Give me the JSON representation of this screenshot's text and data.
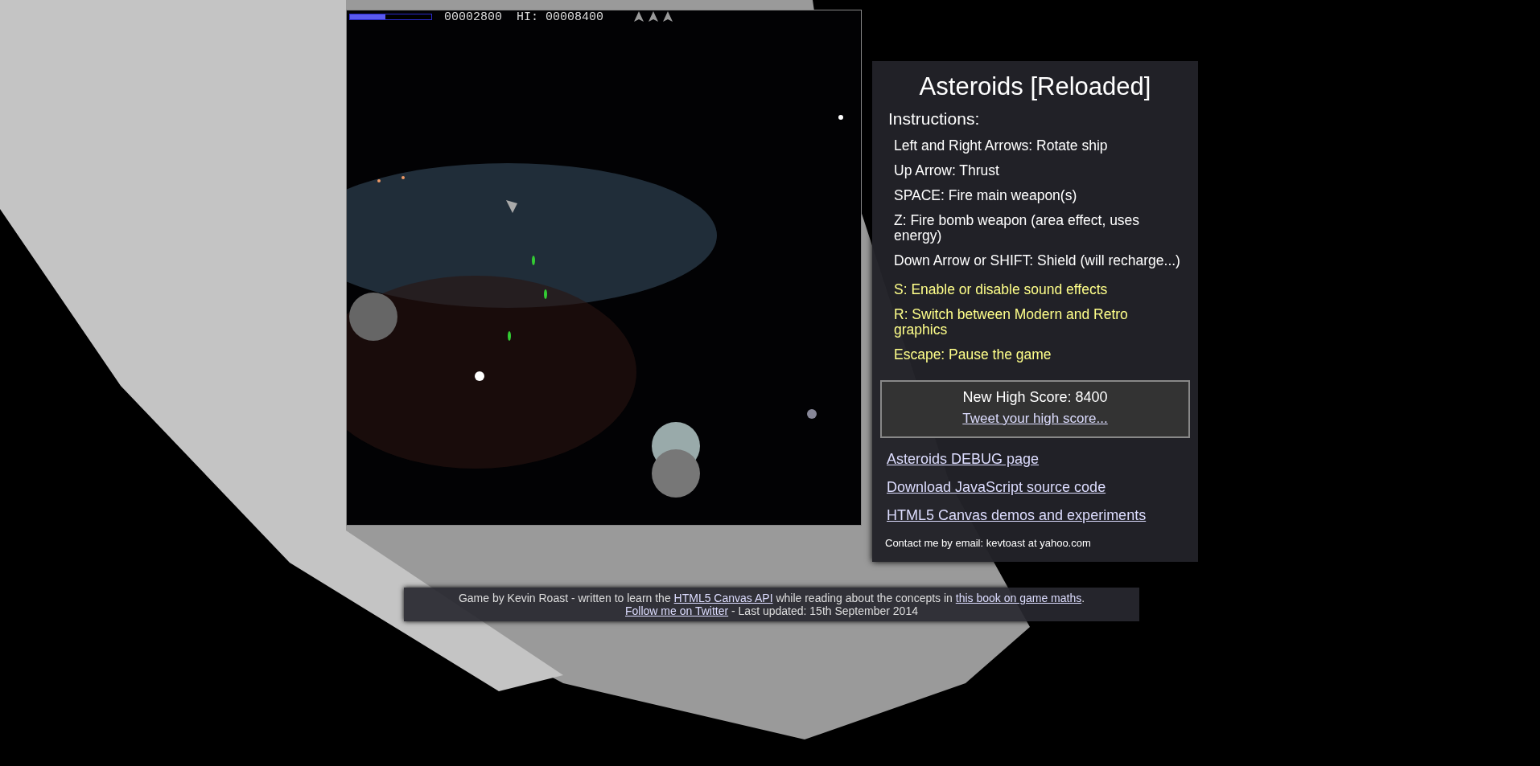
{
  "game": {
    "energy": {
      "level": 0.44
    },
    "score": "00002800",
    "hi_score": "HI: 00008400"
  },
  "panel": {
    "title": "Asteroids [Reloaded]",
    "instructions_heading": "Instructions:",
    "instructions": [
      {
        "text": "Left and Right Arrows: Rotate ship",
        "kind": "control"
      },
      {
        "text": "Up Arrow: Thrust",
        "kind": "control"
      },
      {
        "text": "SPACE: Fire main weapon(s)",
        "kind": "control"
      },
      {
        "text": "Z: Fire bomb weapon (area effect, uses energy)",
        "kind": "control"
      },
      {
        "text": "Down Arrow or SHIFT: Shield (will recharge...)",
        "kind": "control"
      },
      {
        "text": "S: Enable or disable sound effects",
        "kind": "option"
      },
      {
        "text": "R: Switch between Modern and Retro graphics",
        "kind": "option"
      },
      {
        "text": "Escape: Pause the game",
        "kind": "option"
      }
    ],
    "high_score": {
      "text": "New High Score: 8400",
      "link": "Tweet your high score..."
    },
    "links": [
      "Asteroids DEBUG page",
      "Download JavaScript source code",
      "HTML5 Canvas demos and experiments"
    ],
    "contact": "Contact me by email: kevtoast at yahoo.com"
  },
  "footer": {
    "lines": [
      [
        {
          "text": "Game by Kevin Roast - written to learn the ",
          "link": false
        },
        {
          "text": "HTML5 Canvas API",
          "link": true
        },
        {
          "text": " while reading about the concepts in ",
          "link": false
        },
        {
          "text": "this book on game maths",
          "link": true
        },
        {
          "text": ".",
          "link": false
        }
      ],
      [
        {
          "text": "Follow me on Twitter",
          "link": true
        },
        {
          "text": " - Last updated: 15th September 2014",
          "link": false
        }
      ]
    ]
  }
}
